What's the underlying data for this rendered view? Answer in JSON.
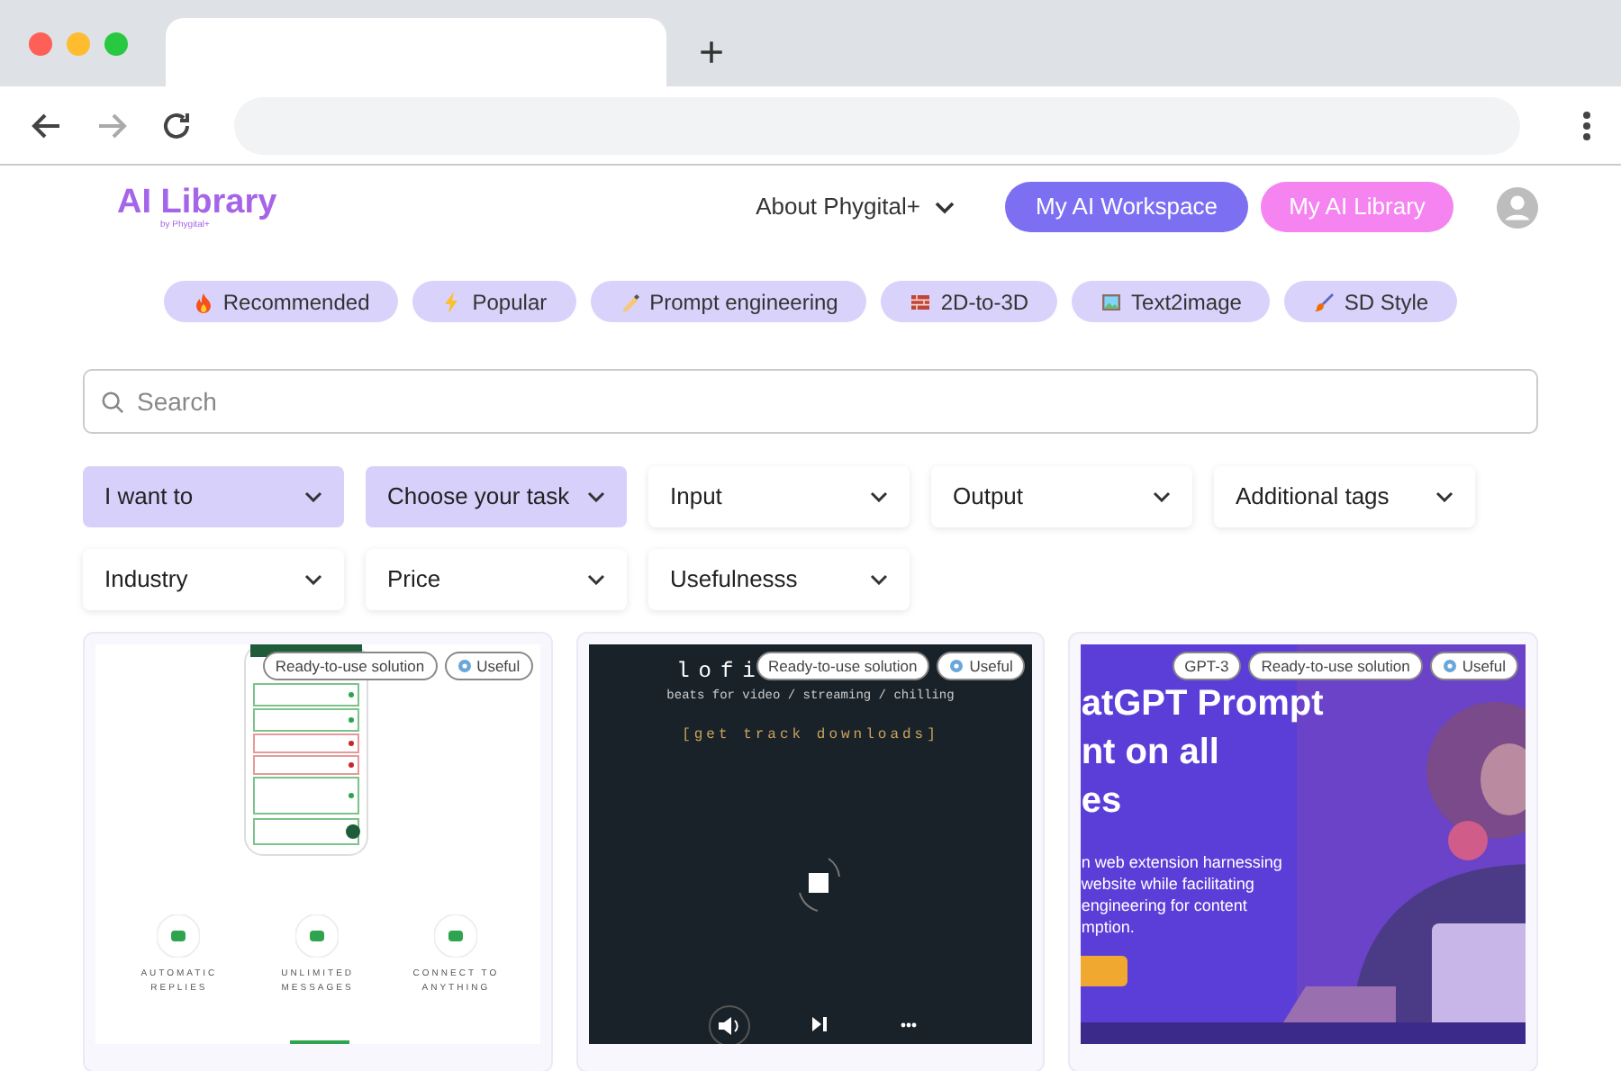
{
  "browser": {
    "forward_disabled": true,
    "new_tab": "+"
  },
  "header": {
    "logo": "AI Library",
    "logo_sub": "by Phygital+",
    "nav": "About Phygital+",
    "buttons": [
      {
        "label": "My AI Workspace",
        "kind": "workspace"
      },
      {
        "label": "My AI Library",
        "kind": "library"
      }
    ]
  },
  "categories": [
    {
      "label": "Recommended"
    },
    {
      "label": "Popular"
    },
    {
      "label": "Prompt engineering"
    },
    {
      "label": "2D-to-3D"
    },
    {
      "label": "Text2image"
    },
    {
      "label": "SD Style"
    }
  ],
  "search": {
    "placeholder": "Search"
  },
  "filters": [
    {
      "label": "I want to",
      "selected": true
    },
    {
      "label": "Choose your task",
      "selected": true
    },
    {
      "label": "Input",
      "selected": false
    },
    {
      "label": "Output",
      "selected": false
    },
    {
      "label": "Additional tags",
      "selected": false
    },
    {
      "label": "Industry",
      "selected": false
    },
    {
      "label": "Price",
      "selected": false
    },
    {
      "label": "Usefulnesss",
      "selected": false
    }
  ],
  "cards": [
    {
      "kind": "chatbot",
      "tags": [
        "Ready-to-use solution",
        "Useful"
      ],
      "features": [
        "AUTOMATIC REPLIES",
        "UNLIMITED MESSAGES",
        "CONNECT TO ANYTHING"
      ]
    },
    {
      "kind": "lofi",
      "tags": [
        "Ready-to-use solution",
        "Useful"
      ],
      "title": "lofi",
      "subtitle": "beats for video / streaming / chilling",
      "link": "[get track downloads]"
    },
    {
      "kind": "promo",
      "tags": [
        "GPT-3",
        "Ready-to-use solution",
        "Useful"
      ],
      "heading": [
        "atGPT Prompt",
        "nt on all",
        "es"
      ],
      "body": [
        "n web extension harnessing",
        "website while facilitating",
        "engineering for content",
        "mption."
      ]
    }
  ]
}
